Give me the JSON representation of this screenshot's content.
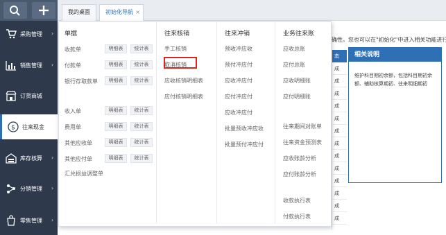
{
  "sidebar": {
    "items": [
      {
        "label": "采购管理",
        "icon": "cart-icon"
      },
      {
        "label": "销售管理",
        "icon": "bar-chart-icon"
      },
      {
        "label": "订货商城",
        "icon": "store-icon"
      },
      {
        "label": "往来现金",
        "icon": "dollar-circle-icon"
      },
      {
        "label": "库存核算",
        "icon": "warehouse-icon"
      },
      {
        "label": "分销管理",
        "icon": "distribution-icon"
      },
      {
        "label": "零售管理",
        "icon": "retail-bag-icon"
      }
    ],
    "active_index": 3
  },
  "tabs": [
    {
      "label": "我的桌面"
    },
    {
      "label": "初始化导航",
      "close": "×"
    }
  ],
  "background": {
    "note": "确性。您也可以在\"初始化\"中进入相关功能进行操作",
    "col_header": "态",
    "col_rows": [
      "成",
      "成",
      "成",
      "成",
      "成",
      "成",
      "成",
      "成",
      "成",
      "成",
      "成",
      "成",
      "成"
    ],
    "related": {
      "title": "相关说明",
      "body": "维护科目期初余额，包括科目期初余额、辅助核算期初、往来明细期初"
    }
  },
  "menu": {
    "col1": {
      "header": "单据",
      "items": [
        {
          "label": "收款单",
          "btn1": "明细表",
          "btn2": "统计表"
        },
        {
          "label": "付款单",
          "btn1": "明细表",
          "btn2": "统计表"
        },
        {
          "label": "银行存取款单",
          "btn1": "明细表",
          "btn2": "统计表"
        },
        {
          "label": "收入单",
          "btn1": "明细表",
          "btn2": "统计表"
        },
        {
          "label": "费用单",
          "btn1": "明细表",
          "btn2": "统计表"
        },
        {
          "label": "其他应收单",
          "btn1": "明细表",
          "btn2": "统计表"
        },
        {
          "label": "其他应付单",
          "btn1": "明细表",
          "btn2": "统计表"
        },
        {
          "label": "汇兑损益调整单"
        }
      ]
    },
    "col2": {
      "header": "往来核销",
      "items": [
        "手工核销",
        "取消核销",
        "应收核销明细表",
        "应付核销明细表"
      ],
      "highlight": "取消核销"
    },
    "col3": {
      "header": "往来冲销",
      "items": [
        "预收冲应收",
        "预付冲应付",
        "应收冲应付",
        "应付冲应付",
        "应收冲应付",
        "批量预收冲应收",
        "批量预付冲应付"
      ]
    },
    "col4": {
      "header": "业务往来账",
      "items": [
        "应收总账",
        "应付总账",
        "应收明细账",
        "应付明细账",
        "往来期间对账单",
        "往来资金预测表",
        "应收账龄分析",
        "应付账龄分析",
        "收款执行表",
        "付款执行表"
      ]
    }
  },
  "colors": {
    "sidebar_bg": "#2e3a4c",
    "accent": "#2e6fb6",
    "highlight": "#d9261c"
  }
}
